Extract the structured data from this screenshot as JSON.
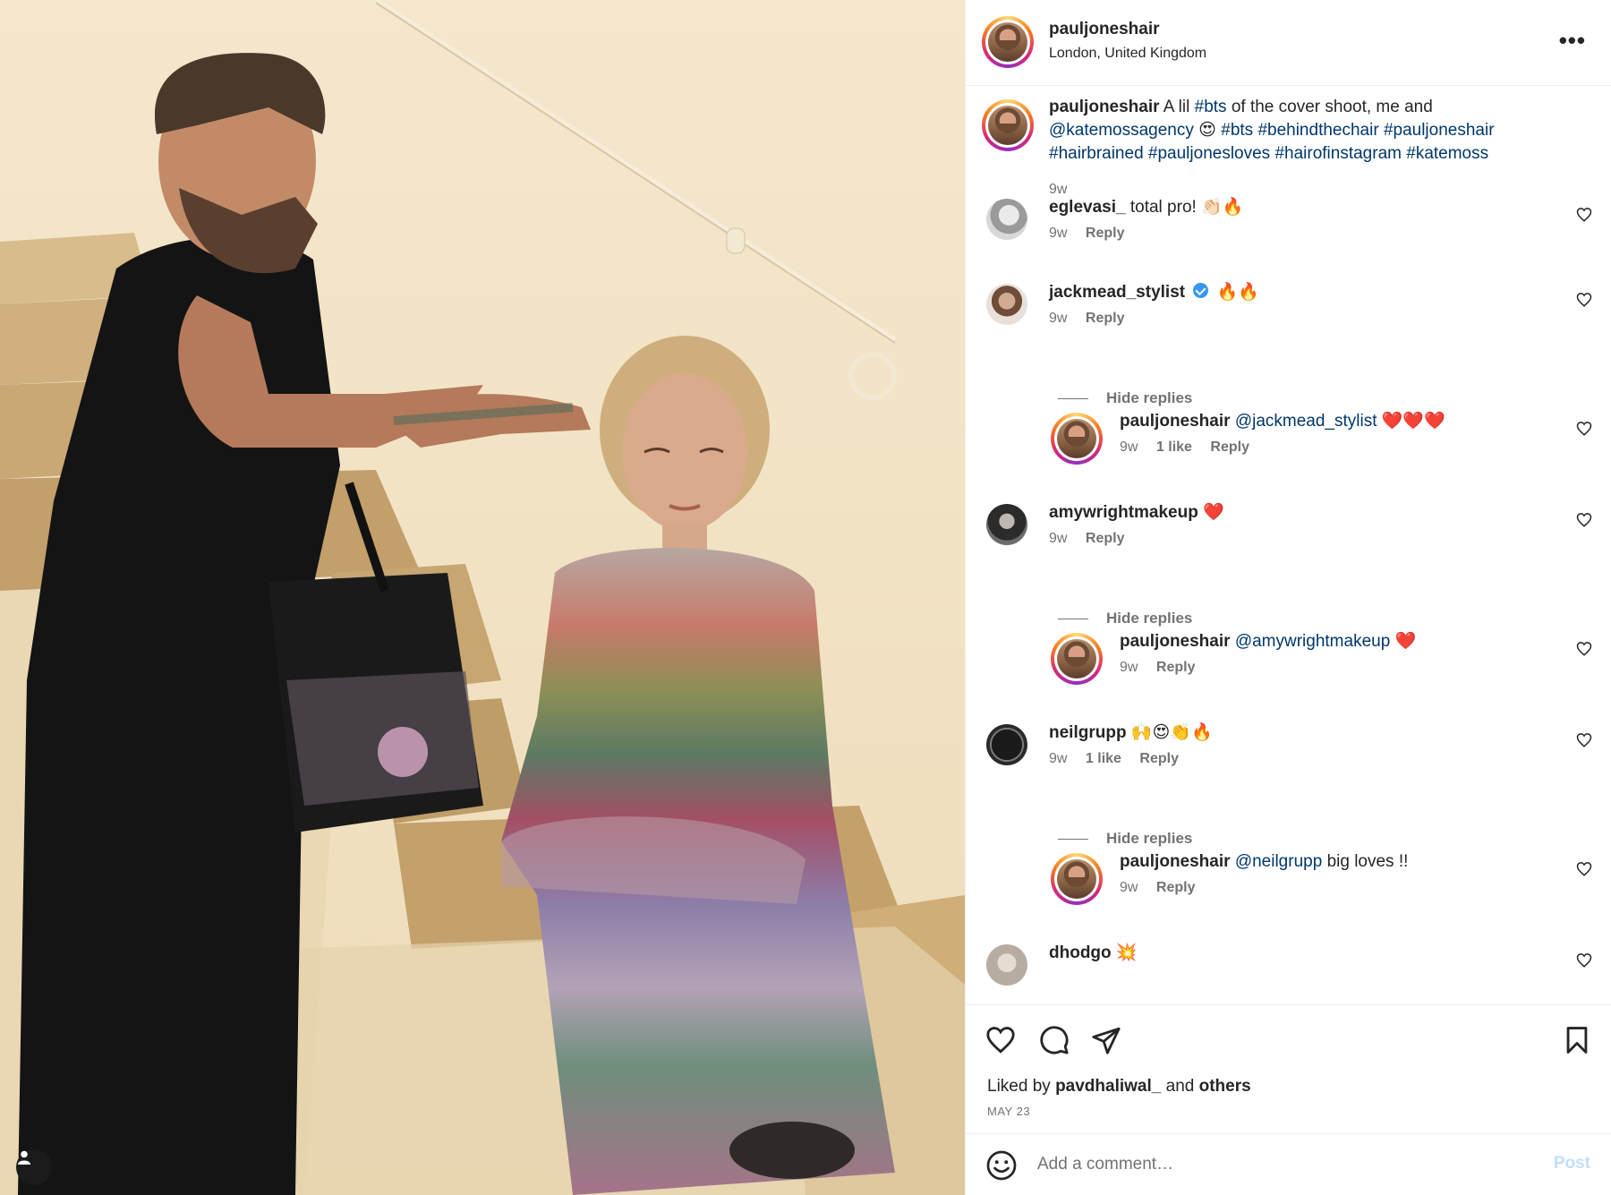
{
  "post": {
    "username": "pauljoneshair",
    "location": "London, United Kingdom",
    "more_icon": "more-horizontal-icon"
  },
  "caption": {
    "username": "pauljoneshair",
    "t1": "A lil",
    "tag1": "#bts",
    "t2": "of the cover shoot, me and",
    "mention": "@katemossagency",
    "emoji1": "😍",
    "tags_line2": "#bts #behindthechair #pauljoneshair",
    "tags_line3": "#hairbrained #pauljonesloves #hairofinstagram #katemoss",
    "time": "9w"
  },
  "comments": [
    {
      "user": "eglevasi_",
      "text": "total pro! 👏🏻🔥",
      "time": "9w",
      "reply": "Reply"
    },
    {
      "user": "jackmead_stylist",
      "text": "🔥🔥",
      "time": "9w",
      "reply": "Reply",
      "verified": true
    },
    {
      "hide": "Hide replies"
    },
    {
      "user": "pauljoneshair",
      "mention": "@jackmead_stylist",
      "text": "❤️❤️❤️",
      "time": "9w",
      "likes": "1 like",
      "reply": "Reply"
    },
    {
      "user": "amywrightmakeup",
      "text": "❤️",
      "time": "9w",
      "reply": "Reply"
    },
    {
      "hide": "Hide replies"
    },
    {
      "user": "pauljoneshair",
      "mention": "@amywrightmakeup",
      "text": "❤️",
      "time": "9w",
      "reply": "Reply"
    },
    {
      "user": "neilgrupp",
      "text": "🙌😍👏🔥",
      "time": "9w",
      "likes": "1 like",
      "reply": "Reply"
    },
    {
      "hide": "Hide replies"
    },
    {
      "user": "pauljoneshair",
      "mention": "@neilgrupp",
      "text": "big loves !!",
      "time": "9w",
      "reply": "Reply"
    },
    {
      "user": "dhodgo",
      "text": "💥"
    }
  ],
  "actions": {
    "liked_prefix": "Liked by",
    "liked_user": "pavdhaliwal_",
    "liked_and": "and",
    "liked_others": "others",
    "date": "MAY 23"
  },
  "add_comment": {
    "placeholder": "Add a comment…",
    "post_label": "Post"
  },
  "colors": {
    "link": "#00376b",
    "muted": "#737373",
    "post_disabled": "#c0dffd",
    "verified": "#3897f0"
  }
}
